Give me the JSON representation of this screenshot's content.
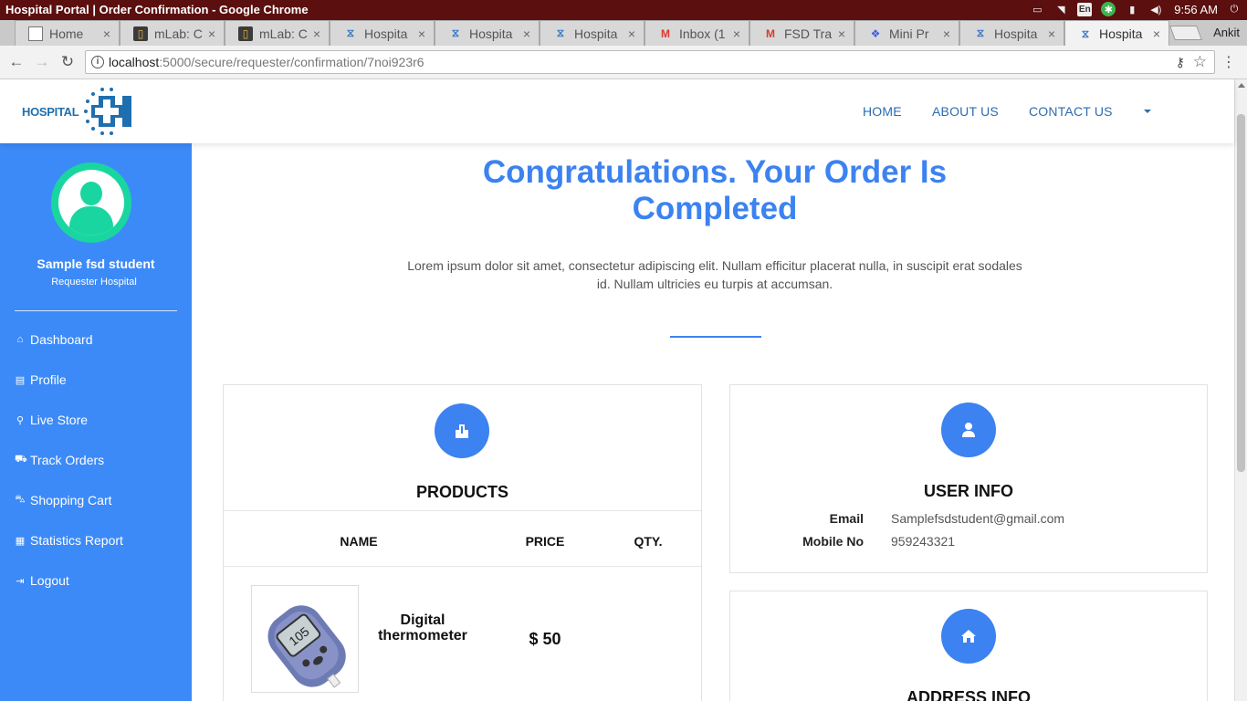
{
  "window": {
    "title": "Hospital Portal | Order Confirmation - Google Chrome",
    "time": "9:56 AM",
    "lang": "En",
    "profile": "Ankit"
  },
  "tabs": [
    {
      "label": "Home",
      "icon": "doc-icon"
    },
    {
      "label": "mLab: C",
      "icon": "mlab-icon"
    },
    {
      "label": "mLab: C",
      "icon": "mlab-icon"
    },
    {
      "label": "Hospita",
      "icon": "hospital-icon"
    },
    {
      "label": "Hospita",
      "icon": "hospital-icon"
    },
    {
      "label": "Hospita",
      "icon": "hospital-icon"
    },
    {
      "label": "Inbox (1",
      "icon": "gmail-icon"
    },
    {
      "label": "FSD Tra",
      "icon": "gmail-icon"
    },
    {
      "label": "Mini Pr",
      "icon": "dropbox-icon"
    },
    {
      "label": "Hospita",
      "icon": "hospital-icon"
    },
    {
      "label": "Hospita",
      "icon": "hospital-icon",
      "active": true
    }
  ],
  "address": {
    "host": "localhost",
    "path": ":5000/secure/requester/confirmation/7noi923r6"
  },
  "brand": {
    "logo_text": "HOSPITAL"
  },
  "nav": {
    "home": "HOME",
    "about": "ABOUT US",
    "contact": "CONTACT US"
  },
  "sidebar": {
    "user_name": "Sample fsd student",
    "user_role": "Requester Hospital",
    "items": [
      {
        "label": "Dashboard",
        "icon": "home-icon"
      },
      {
        "label": "Profile",
        "icon": "id-card-icon"
      },
      {
        "label": "Live Store",
        "icon": "search-icon"
      },
      {
        "label": "Track Orders",
        "icon": "truck-icon"
      },
      {
        "label": "Shopping Cart",
        "icon": "cart-icon"
      },
      {
        "label": "Statistics Report",
        "icon": "report-icon"
      },
      {
        "label": "Logout",
        "icon": "logout-icon"
      }
    ]
  },
  "confirmation": {
    "title_line1": "Congratulations. Your Order Is",
    "title_line2": "Completed",
    "desc_line1": "Lorem ipsum dolor sit amet, consectetur adipiscing elit. Nullam efficitur placerat nulla, in suscipit erat sodales",
    "desc_line2": "id. Nullam ultricies eu turpis at accumsan."
  },
  "products": {
    "title": "PRODUCTS",
    "columns": [
      "NAME",
      "PRICE",
      "QTY."
    ],
    "items": [
      {
        "name_line1": "Digital",
        "name_line2": "thermometer",
        "price": "$ 50"
      }
    ]
  },
  "user_info": {
    "title": "USER INFO",
    "email_label": "Email",
    "email": "Samplefsdstudent@gmail.com",
    "mobile_label": "Mobile No",
    "mobile": "959243321"
  },
  "address_info": {
    "title": "ADDRESS INFO"
  },
  "colors": {
    "primary": "#3c82f0",
    "sidebar": "#3c8af7",
    "avatar": "#19d6a0",
    "link": "#2b6cb0"
  }
}
